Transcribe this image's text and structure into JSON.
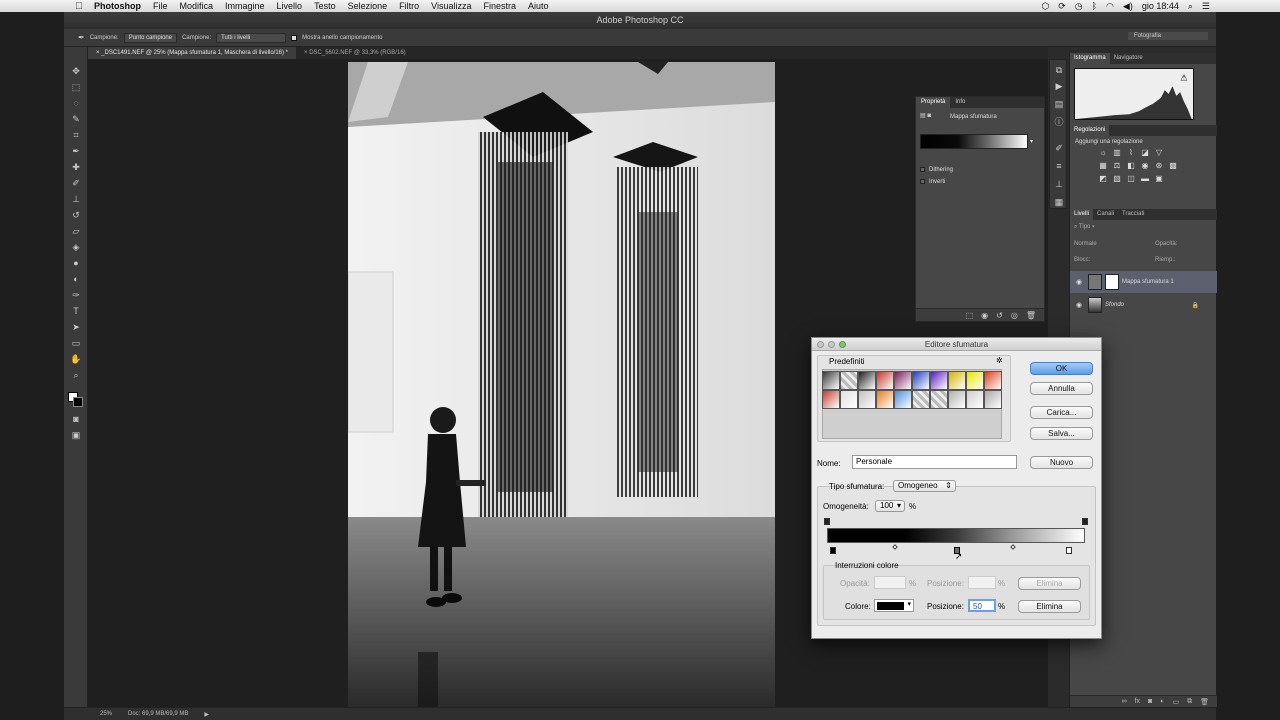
{
  "menubar": {
    "apple": "",
    "app": "Photoshop",
    "items": [
      "File",
      "Modifica",
      "Immagine",
      "Livello",
      "Testo",
      "Selezione",
      "Filtro",
      "Visualizza",
      "Finestra",
      "Aiuto"
    ],
    "clock": "gio 18:44"
  },
  "window": {
    "title": "Adobe Photoshop CC"
  },
  "options": {
    "campione_label": "Campione:",
    "campione_value": "Punto campione",
    "campione2_label": "Campione:",
    "campione2_value": "Tutti i livelli",
    "anello_label": "Mostra anello campionamento",
    "workspace": "Fotografia"
  },
  "tabs": [
    {
      "label": "_DSC1491.NEF @ 25% (Mappa sfumatura 1, Maschera di livello/16) *"
    },
    {
      "label": "DSC_5602.NEF @ 33,3% (RGB/16)"
    }
  ],
  "status": {
    "zoom": "25%",
    "doc": "Doc: 69,9 MB/69,9 MB"
  },
  "properties": {
    "tab1": "Proprietà",
    "tab2": "Info",
    "title": "Mappa sfumatura",
    "dithering": "Dithering",
    "inverti": "Inverti"
  },
  "right": {
    "histogram_tab": "Istogramma",
    "navigator_tab": "Navigatore",
    "adjustments_tab": "Regolazioni",
    "adjustments_title": "Aggiungi una regolazione",
    "layers_tab": "Livelli",
    "channels_tab": "Canali",
    "paths_tab": "Tracciati",
    "kind": "Tipo",
    "blend": "Normale",
    "opacity": "Opacità:",
    "lock": "Blocc:",
    "fill": "Riemp.:",
    "layers": [
      {
        "name": "Mappa sfumatura 1"
      },
      {
        "name": "Sfondo"
      }
    ]
  },
  "dialog": {
    "title": "Editore sfumatura",
    "presets": "Predefiniti",
    "ok": "OK",
    "annulla": "Annulla",
    "carica": "Carica...",
    "salva": "Salva...",
    "nome_label": "Nome:",
    "nome_value": "Personale",
    "nuovo": "Nuovo",
    "tipo_label": "Tipo sfumatura:",
    "tipo_value": "Omogeneo",
    "omogeneita_label": "Omogeneità:",
    "omogeneita_value": "100",
    "percent": "%",
    "interruzioni": "Interruzioni colore",
    "opacita_label": "Opacità:",
    "posizione_label": "Posizione:",
    "elimina": "Elimina",
    "colore_label": "Colore:",
    "posizione_value": "50",
    "swatch_colors": [
      "#3a3a3a",
      "#d0d0d0",
      "#222",
      "#c0392b",
      "#7a1f5c",
      "#1f3fbf",
      "#5a1fbf",
      "#d4b400",
      "#e6e600",
      "#e04020",
      "#c04030",
      "#e0e0e0",
      "#c0c0c0",
      "#e67e22",
      "#4a90d9",
      "#8e44ad",
      "#c0c0c0",
      "#b0b0b0",
      "#d0d0d0",
      "#a8a8a8"
    ]
  }
}
